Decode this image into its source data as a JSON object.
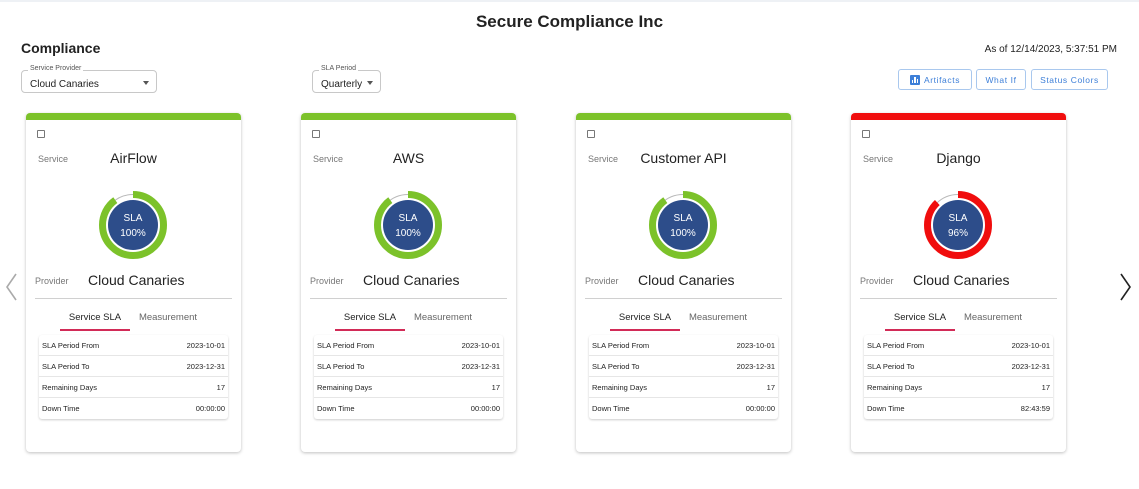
{
  "header": {
    "company": "Secure Compliance Inc",
    "page_title": "Compliance",
    "as_of": "As of 12/14/2023, 5:37:51 PM"
  },
  "filters": {
    "provider": {
      "label": "Service Provider",
      "value": "Cloud Canaries"
    },
    "period": {
      "label": "SLA Period",
      "value": "Quarterly"
    }
  },
  "toolbar": {
    "artifacts": "Artifacts",
    "what_if": "What If",
    "status_colors": "Status Colors"
  },
  "card_labels": {
    "service": "Service",
    "provider": "Provider",
    "tab_sla": "Service SLA",
    "tab_measurement": "Measurement",
    "sla": "SLA",
    "row_from": "SLA Period From",
    "row_to": "SLA Period To",
    "row_remaining": "Remaining Days",
    "row_down": "Down Time"
  },
  "colors": {
    "ok": "#7cc22a",
    "bad": "#f00d0d",
    "donut_center": "#2d4d8a",
    "accent": "#3d7fd8",
    "tab_underline": "#d22b57"
  },
  "cards": [
    {
      "service": "AirFlow",
      "provider": "Cloud Canaries",
      "sla_text": "100%",
      "sla_fraction": 0.9,
      "status": "ok",
      "period_from": "2023-10-01",
      "period_to": "2023-12-31",
      "remaining_days": "17",
      "down_time": "00:00:00"
    },
    {
      "service": "AWS",
      "provider": "Cloud Canaries",
      "sla_text": "100%",
      "sla_fraction": 0.9,
      "status": "ok",
      "period_from": "2023-10-01",
      "period_to": "2023-12-31",
      "remaining_days": "17",
      "down_time": "00:00:00"
    },
    {
      "service": "Customer API",
      "provider": "Cloud Canaries",
      "sla_text": "100%",
      "sla_fraction": 0.9,
      "status": "ok",
      "period_from": "2023-10-01",
      "period_to": "2023-12-31",
      "remaining_days": "17",
      "down_time": "00:00:00"
    },
    {
      "service": "Django",
      "provider": "Cloud Canaries",
      "sla_text": "96%",
      "sla_fraction": 0.88,
      "status": "bad",
      "period_from": "2023-10-01",
      "period_to": "2023-12-31",
      "remaining_days": "17",
      "down_time": "82:43:59"
    }
  ]
}
